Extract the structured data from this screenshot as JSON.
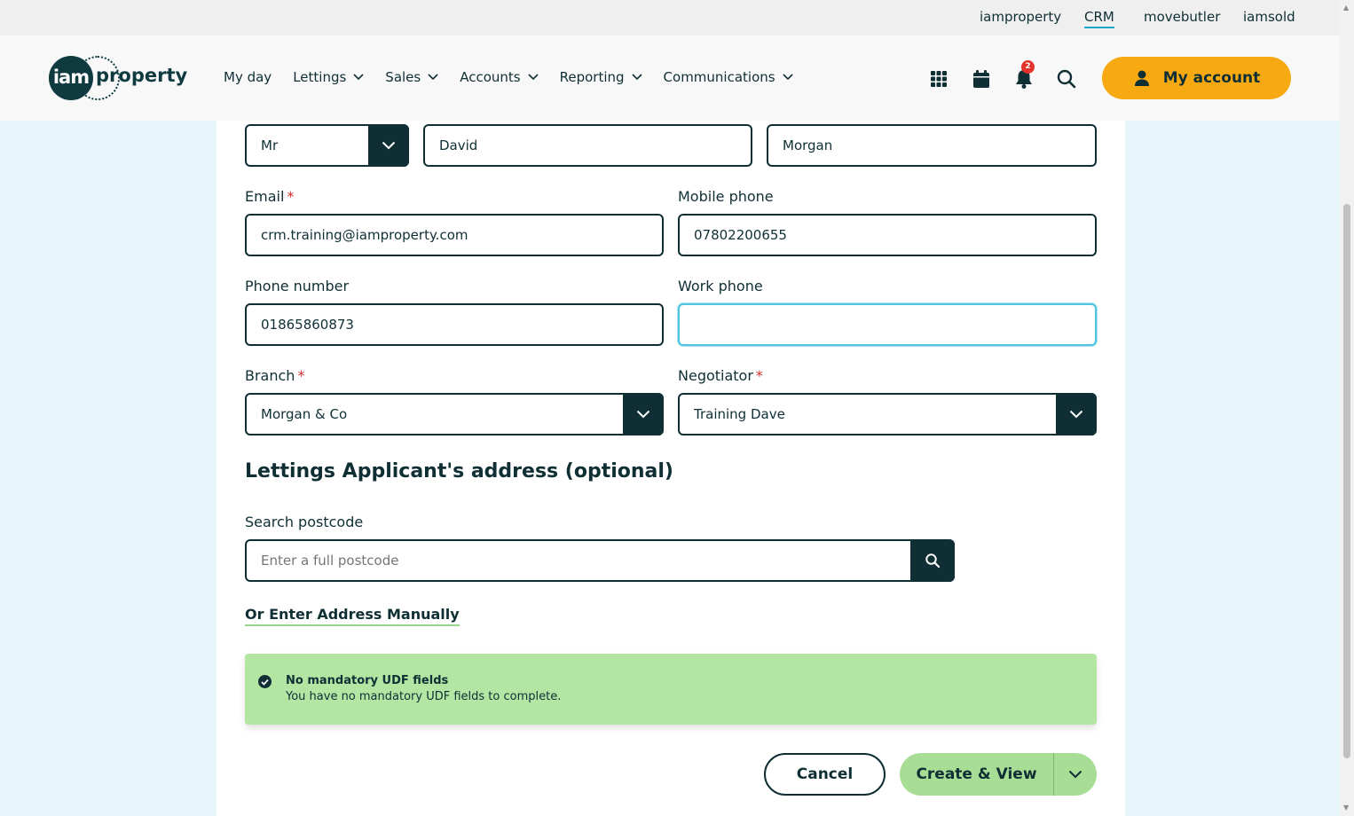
{
  "topbar": {
    "links": [
      "iamproperty",
      "CRM",
      "movebutler",
      "iamsold"
    ],
    "active": "CRM",
    "active_color": "#1aa6c9"
  },
  "header": {
    "logo_mark": "iam",
    "logo_word": "property",
    "nav": [
      "My day",
      "Lettings",
      "Sales",
      "Accounts",
      "Reporting",
      "Communications"
    ],
    "icons": [
      "apps-grid-icon",
      "calendar-icon",
      "bell-icon",
      "search-icon"
    ],
    "notification_count": "2",
    "account_label": "My account",
    "account_color": "#f7a912"
  },
  "form": {
    "title_value": "Mr",
    "first_name": "David",
    "last_name": "Morgan",
    "email_label": "Email",
    "email_value": "crm.training@iamproperty.com",
    "mobile_label": "Mobile phone",
    "mobile_value": "07802200655",
    "phone_label": "Phone number",
    "phone_value": "01865860873",
    "work_label": "Work phone",
    "work_value": "",
    "branch_label": "Branch",
    "branch_value": "Morgan & Co",
    "negotiator_label": "Negotiator",
    "negotiator_value": "Training Dave",
    "required_mark": "*"
  },
  "address": {
    "section_title": "Lettings Applicant's address (optional)",
    "search_label": "Search postcode",
    "search_placeholder": "Enter a full postcode",
    "manual_link": "Or Enter Address Manually"
  },
  "alert": {
    "title": "No mandatory UDF fields",
    "message": "You have no mandatory UDF fields to complete.",
    "color": "#b3e5a3"
  },
  "actions": {
    "cancel_label": "Cancel",
    "create_label": "Create & View"
  }
}
